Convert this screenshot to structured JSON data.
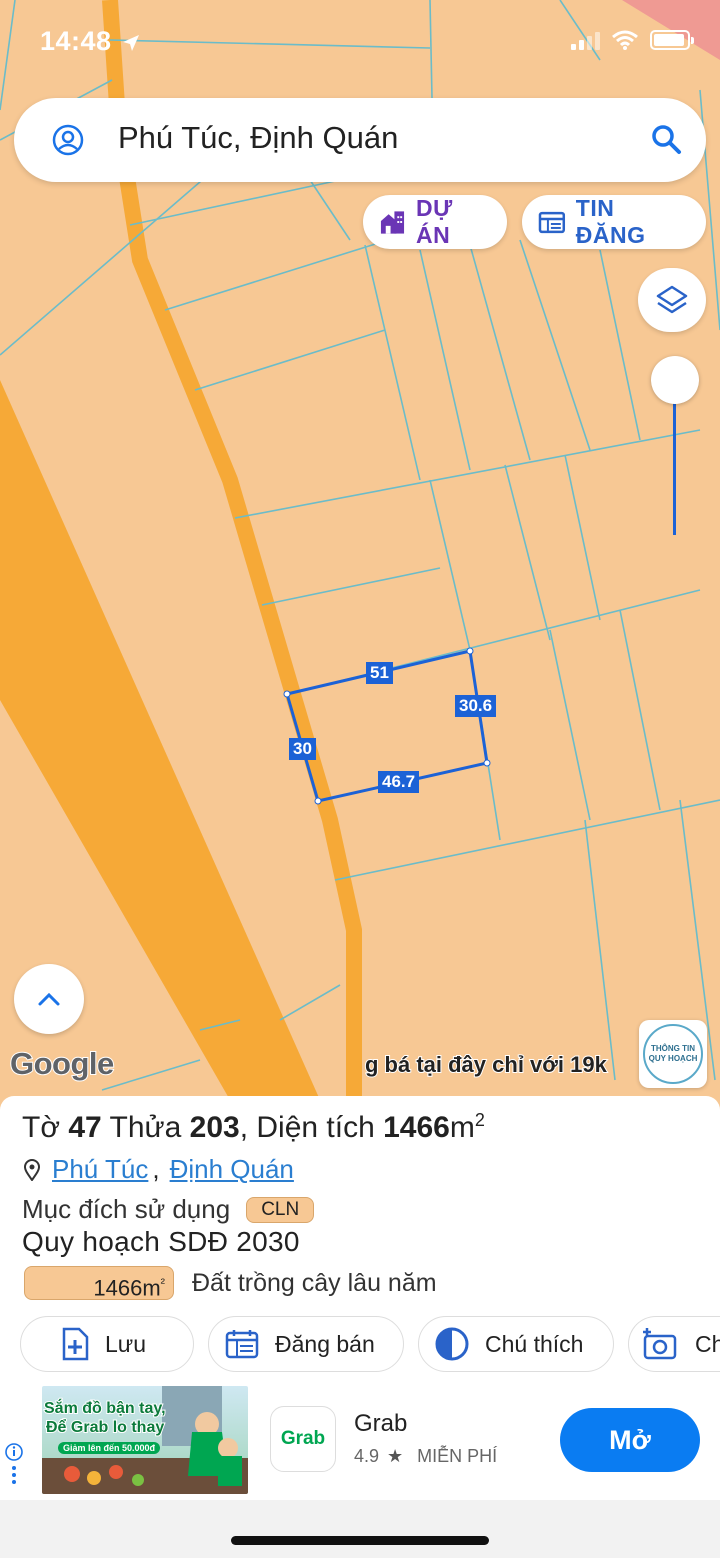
{
  "status_bar": {
    "time": "14:48"
  },
  "search": {
    "text": "Phú Túc, Định Quán"
  },
  "chips": {
    "du_an": "DỰ ÁN",
    "tin_dang": "TIN ĐĂNG"
  },
  "map": {
    "edge_labels": {
      "top": "51",
      "right": "30.6",
      "left": "30",
      "bottom": "46.7"
    },
    "attribution": "Google",
    "ad_marquee": "g bá tại đây chỉ với 19k",
    "planning_badge": {
      "line1": "THÔNG TIN",
      "line2": "QUY HOẠCH"
    },
    "colors": {
      "land": "#f7c894",
      "road": "#f6a937",
      "parcel_line": "#6bbcc9",
      "selection": "#1c62d6"
    }
  },
  "sheet": {
    "title_prefix": "Tờ",
    "sheet_no": "47",
    "plot_word": "Thửa",
    "plot_no": "203",
    "area_word": ", Diện tích",
    "area_value": "1466",
    "area_unit": "m",
    "area_sup": "2",
    "location": {
      "commune": "Phú Túc",
      "separator": ",",
      "district": "Định Quán"
    },
    "purpose_label": "Mục đích sử dụng",
    "purpose_code": "CLN",
    "plan_label": "Quy hoạch SDĐ 2030",
    "plan_area": "1466m",
    "plan_area_sup": "²",
    "plan_desc": "Đất trồng cây lâu năm",
    "actions": {
      "save": "Lưu",
      "sell": "Đăng bán",
      "legend": "Chú thích",
      "photo": "Ch"
    }
  },
  "ad": {
    "image_text1": "Sắm đồ bận tay,",
    "image_text2": "Để Grab lo thay",
    "image_promo": "Giảm lên đến 50.000đ",
    "app_icon_text": "Grab",
    "app_name": "Grab",
    "rating": "4.9",
    "price": "MIỄN PHÍ",
    "open_label": "Mở"
  }
}
